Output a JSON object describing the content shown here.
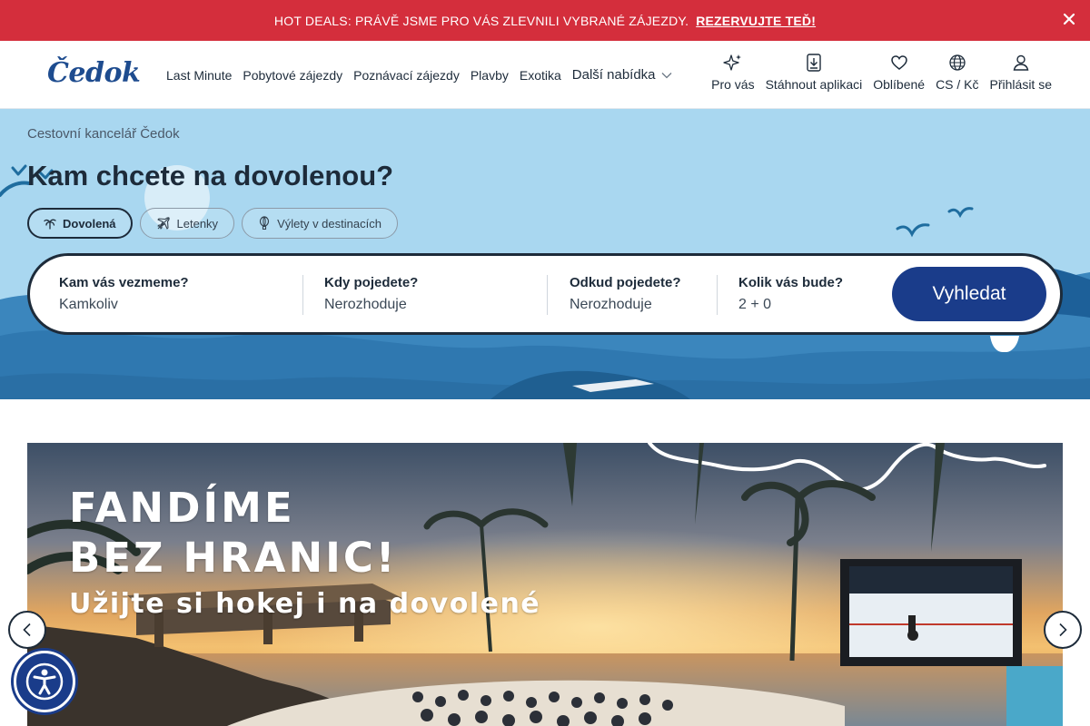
{
  "promo": {
    "text": "HOT DEALS: PRÁVĚ JSME PRO VÁS ZLEVNILI VYBRANÉ ZÁJEZDY.",
    "link": "REZERVUJTE TEĎ!",
    "close_icon": "close-icon"
  },
  "header": {
    "logo": "Čedok",
    "nav": [
      "Last Minute",
      "Pobytové zájezdy",
      "Poznávací zájezdy",
      "Plavby",
      "Exotika"
    ],
    "more": "Další nabídka",
    "utils": [
      {
        "label": "Pro vás",
        "icon": "sparkle-icon"
      },
      {
        "label": "Stáhnout aplikaci",
        "icon": "download-icon"
      },
      {
        "label": "Oblíbené",
        "icon": "heart-icon"
      },
      {
        "label": "CS / Kč",
        "icon": "globe-icon"
      },
      {
        "label": "Přihlásit se",
        "icon": "user-icon"
      }
    ]
  },
  "hero": {
    "breadcrumb": "Cestovní kancelář Čedok",
    "title": "Kam chcete na dovolenou?",
    "tabs": [
      {
        "label": "Dovolená",
        "icon": "palm-icon",
        "active": true
      },
      {
        "label": "Letenky",
        "icon": "plane-icon",
        "active": false
      },
      {
        "label": "Výlety v destinacích",
        "icon": "balloon-icon",
        "active": false
      }
    ]
  },
  "search": {
    "fields": [
      {
        "label": "Kam vás vezmeme?",
        "value": "Kamkoliv"
      },
      {
        "label": "Kdy pojedete?",
        "value": "Nerozhoduje"
      },
      {
        "label": "Odkud pojedete?",
        "value": "Nerozhoduje"
      },
      {
        "label": "Kolik vás bude?",
        "value": "2 + 0"
      }
    ],
    "button": "Vyhledat"
  },
  "banner": {
    "headline_line1": "FANDÍME",
    "headline_line2": "BEZ HRANIC!",
    "subline": "Užijte si hokej i na dovolené"
  },
  "colors": {
    "promo_red": "#d42e3c",
    "brand_blue": "#1a3c8a",
    "sky": "#a9d7f0",
    "sea_dark": "#1f6d9f"
  }
}
